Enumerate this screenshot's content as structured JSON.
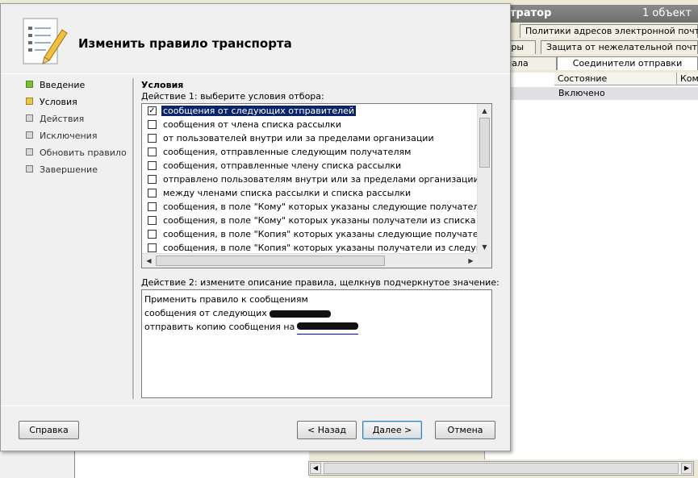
{
  "background": {
    "header_title": "тратор",
    "header_count": "1 объект",
    "tabs_row1": [
      "Политики адресов электронной почты"
    ],
    "tabs_row2": [
      "тры",
      "Защита от нежелательной почты"
    ],
    "tabs_row3": [
      "нала",
      "Соединители отправки"
    ],
    "columns": [
      "Состояние",
      "Ком"
    ],
    "row_status": "Включено"
  },
  "dialog": {
    "title": "Изменить правило транспорта",
    "nav": [
      {
        "label": "Введение",
        "state": "done"
      },
      {
        "label": "Условия",
        "state": "current"
      },
      {
        "label": "Действия",
        "state": "pending"
      },
      {
        "label": "Исключения",
        "state": "pending"
      },
      {
        "label": "Обновить правило",
        "state": "pending"
      },
      {
        "label": "Завершение",
        "state": "pending"
      }
    ],
    "section_title": "Условия",
    "step1_label": "Действие 1: выберите условия отбора:",
    "conditions": [
      {
        "text": "сообщения от следующих отправителей",
        "checked": true
      },
      {
        "text": "сообщения от члена списка рассылки",
        "checked": false
      },
      {
        "text": "от пользователей внутри или за пределами организации",
        "checked": false
      },
      {
        "text": "сообщения, отправленные следующим получателям",
        "checked": false
      },
      {
        "text": "сообщения, отправленные члену списка рассылки",
        "checked": false
      },
      {
        "text": "отправлено пользователям внутри или за пределами организации",
        "checked": false
      },
      {
        "text": "между членами списка рассылки и списка рассылки",
        "checked": false
      },
      {
        "text": "сообщения, в поле \"Кому\" которых указаны следующие получатели",
        "checked": false
      },
      {
        "text": "сообщения, в поле \"Кому\" которых указаны получатели из списка рассылки",
        "checked": false
      },
      {
        "text": "сообщения, в поле \"Копия\" которых указаны следующие получатели",
        "checked": false
      },
      {
        "text": "сообщения, в поле \"Копия\" которых указаны получатели из следующего списка",
        "checked": false
      }
    ],
    "step2_label": "Действие 2: измените описание правила, щелкнув подчеркнутое значение:",
    "description": {
      "line1": "Применить правило к сообщениям",
      "line2": "сообщения от следующих",
      "line3": "отправить копию сообщения на"
    },
    "buttons": {
      "help": "Справка",
      "back": "< Назад",
      "next": "Далее >",
      "cancel": "Отмена"
    }
  }
}
